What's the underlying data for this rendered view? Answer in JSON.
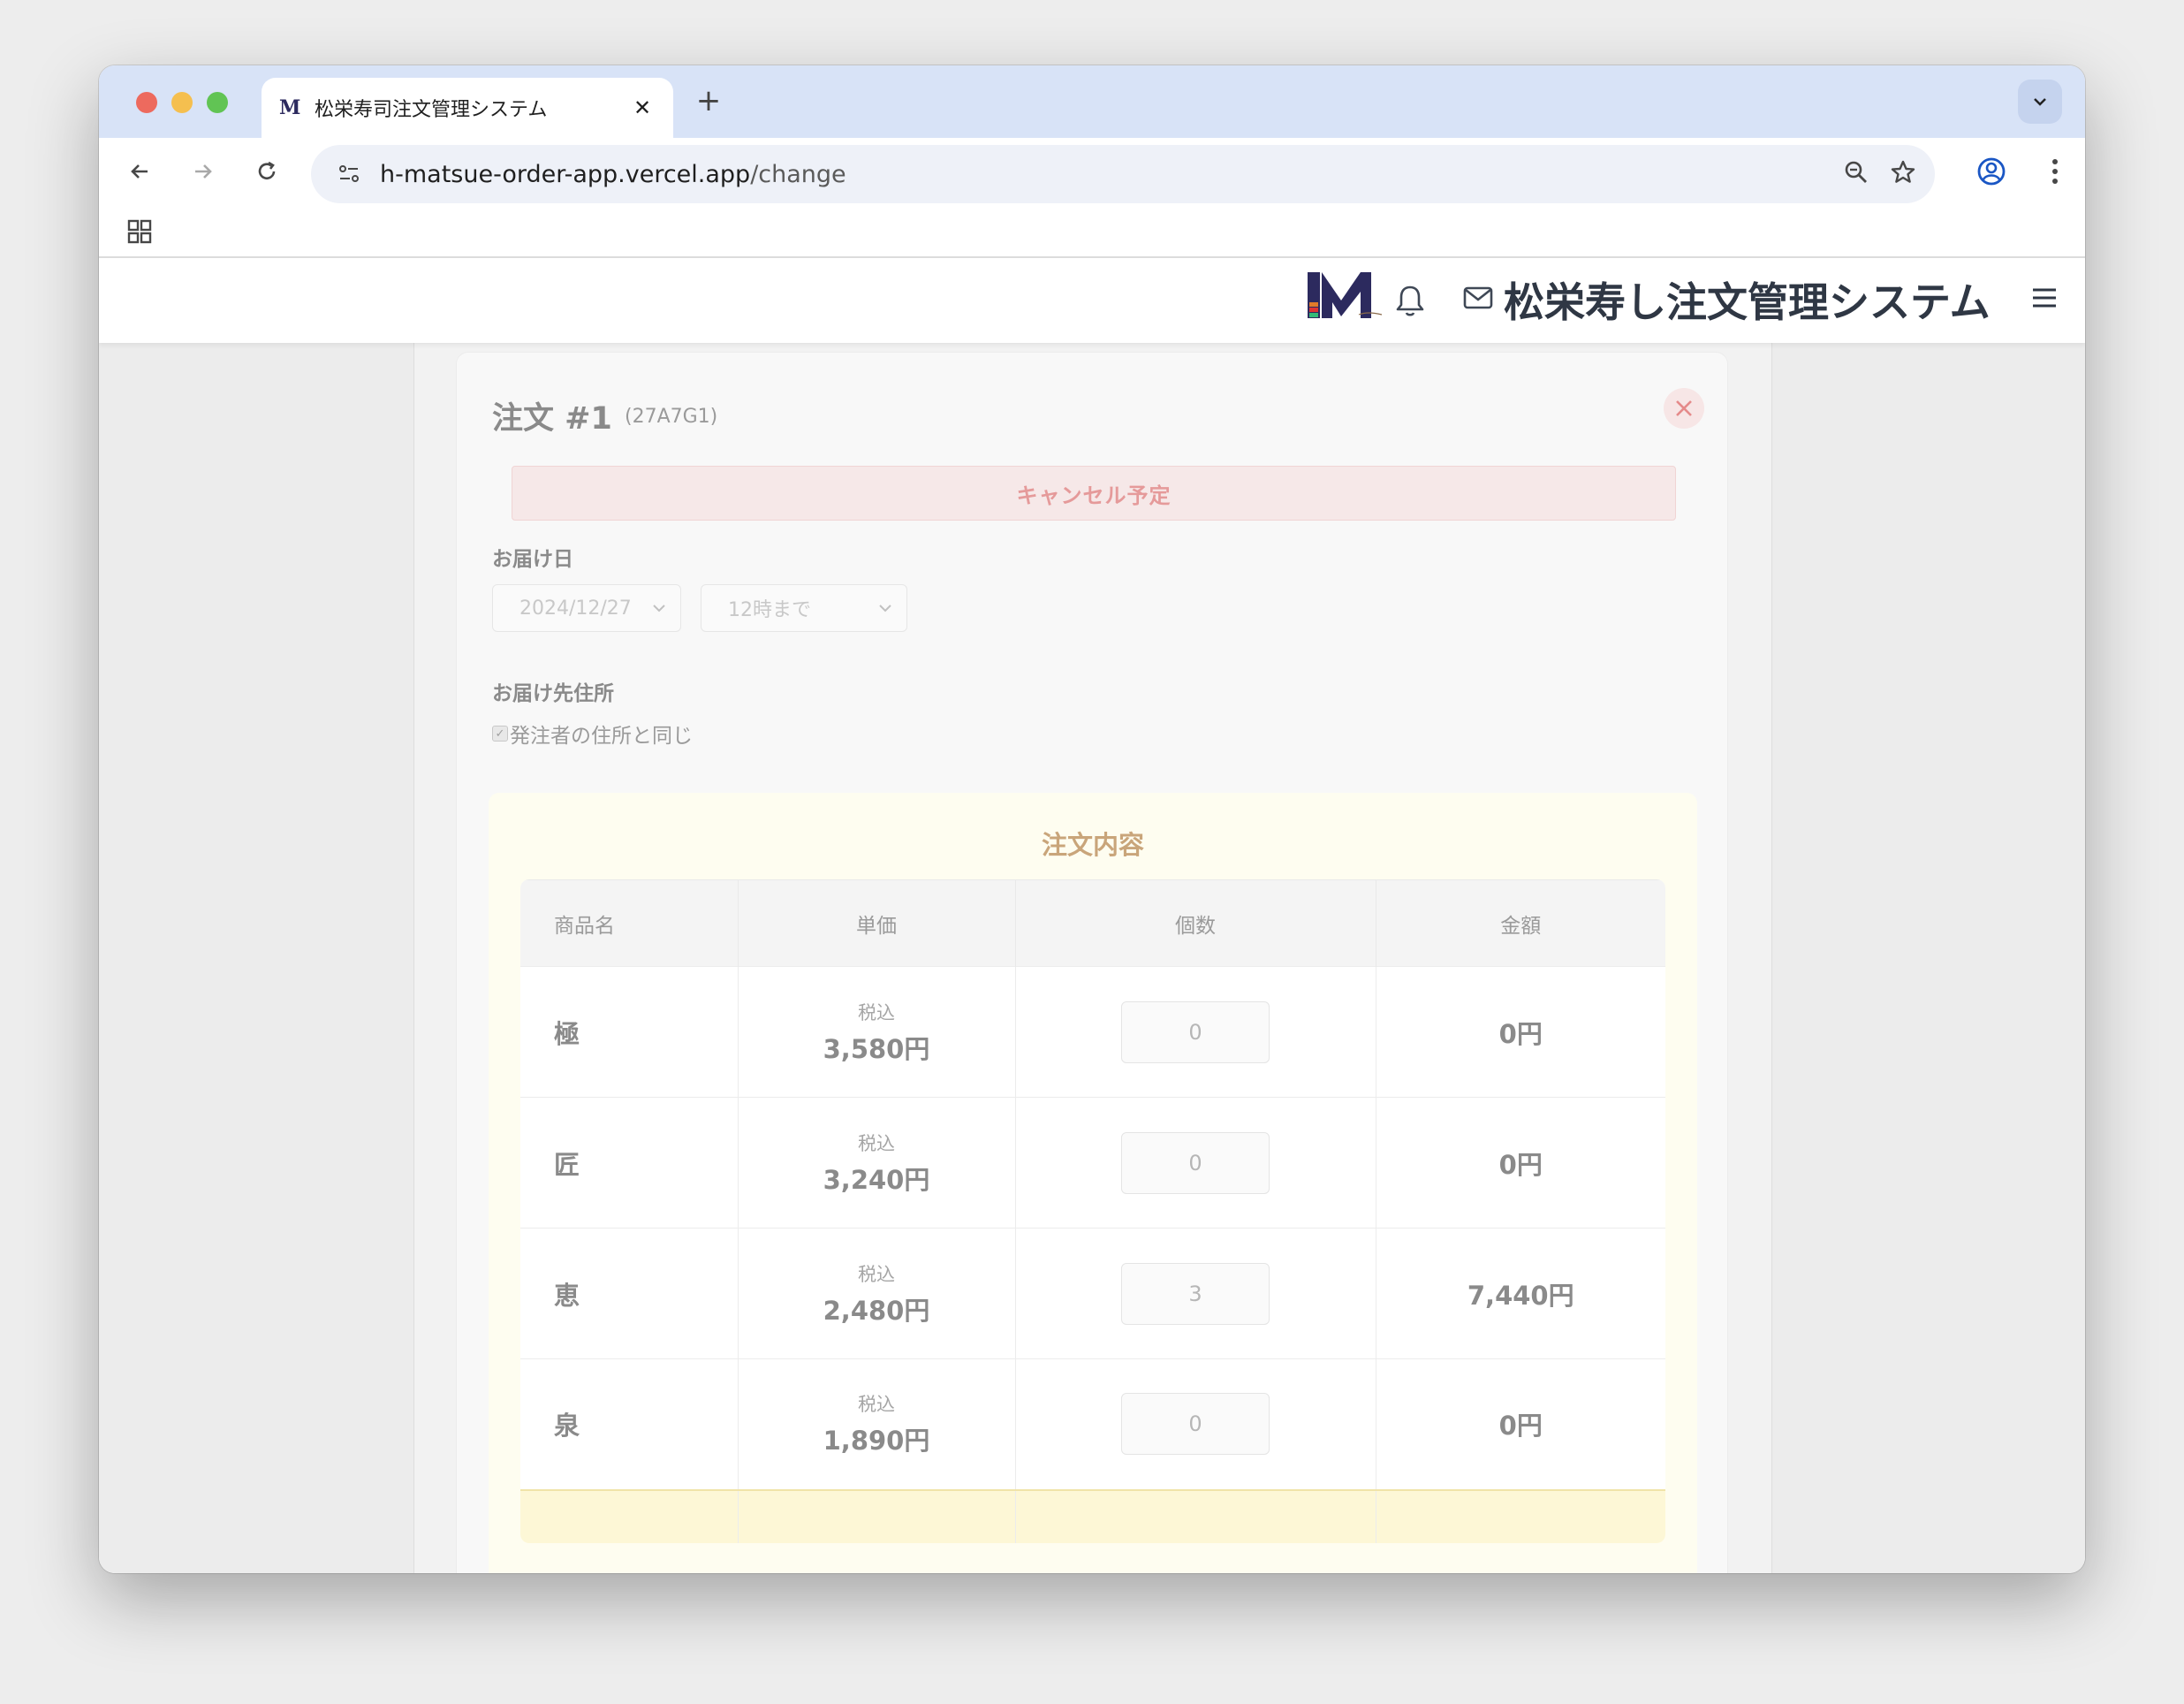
{
  "browser": {
    "tab_title": "松栄寿司注文管理システム",
    "tab_favicon": "M",
    "url_host": "h-matsue-order-app.vercel.app",
    "url_path": "/change"
  },
  "app": {
    "title": "松栄寿し注文管理システム"
  },
  "order": {
    "title": "注文 #1",
    "id": "(27A7G1)",
    "status_banner": "キャンセル予定",
    "delivery_date_label": "お届け日",
    "delivery_date_value": "2024/12/27",
    "delivery_time_value": "12時まで",
    "address_label": "お届け先住所",
    "same_address_label": "発注者の住所と同じ",
    "contents_title": "注文内容"
  },
  "table": {
    "headers": [
      "商品名",
      "単価",
      "個数",
      "金額"
    ],
    "rows": [
      {
        "name": "極",
        "tax": "税込",
        "price": "3,580円",
        "qty": "0",
        "amount": "0円"
      },
      {
        "name": "匠",
        "tax": "税込",
        "price": "3,240円",
        "qty": "0",
        "amount": "0円"
      },
      {
        "name": "恵",
        "tax": "税込",
        "price": "2,480円",
        "qty": "3",
        "amount": "7,440円"
      },
      {
        "name": "泉",
        "tax": "税込",
        "price": "1,890円",
        "qty": "0",
        "amount": "0円"
      }
    ]
  },
  "colors": {
    "tab_strip": "#d8e3f7",
    "cancel_text": "#e59a9a",
    "contents_title": "#c9a57a"
  }
}
